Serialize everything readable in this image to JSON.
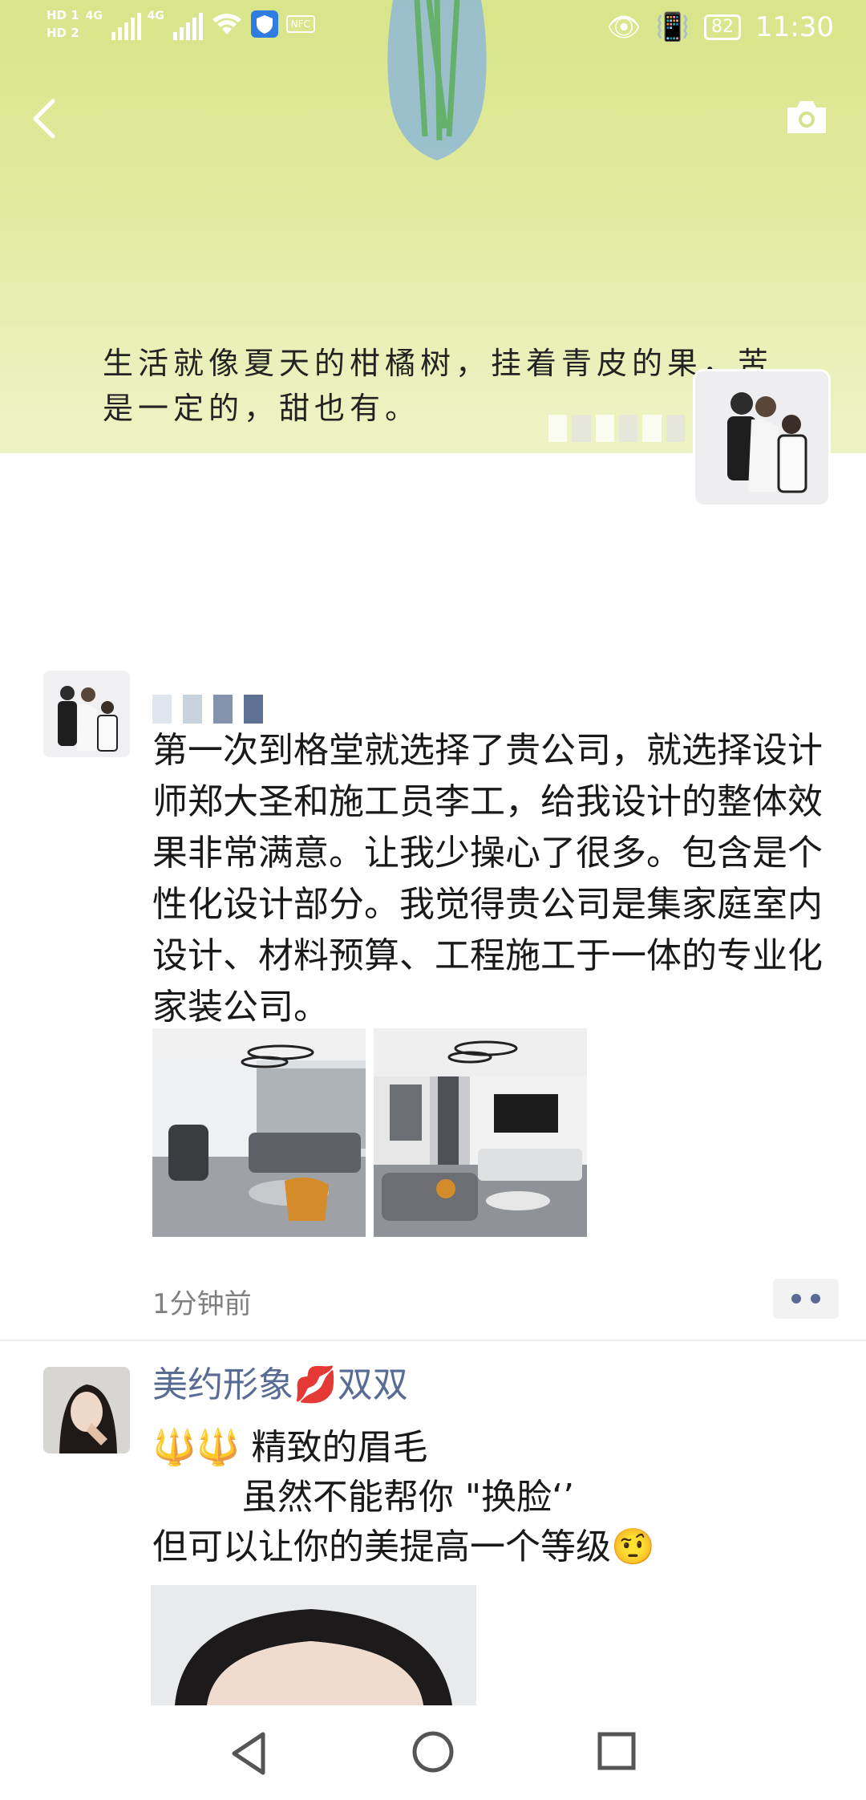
{
  "status_bar": {
    "sim1": "HD 1",
    "sim2": "HD 2",
    "net1": "4G",
    "net2": "4G",
    "nfc_label": "NFC",
    "battery": "82",
    "time": "11:30"
  },
  "header": {
    "back_icon": "chevron-left-icon",
    "camera_icon": "camera-icon"
  },
  "cover": {
    "motto": "生活就像夏天的柑橘树，挂着青皮的果，苦\n是一定的，甜也有。"
  },
  "posts": [
    {
      "text": "第一次到格堂就选择了贵公司，就选择设计师郑大圣和施工员李工，给我设计的整体效果非常满意。让我少操心了很多。包含是个性化设计部分。我觉得贵公司是集家庭室内设计、材料预算、工程施工于一体的专业化家装公司。",
      "time": "1分钟前"
    },
    {
      "nickname": "美约形象💋双双",
      "line1": "🔱🔱 精致的眉毛",
      "line2": "        虽然不能帮你 \"换脸‘’",
      "line3": "但可以让你的美提高一个等级🤨"
    }
  ],
  "colors": {
    "link_blue": "#576b95",
    "cover_green": "#dbe68f"
  }
}
